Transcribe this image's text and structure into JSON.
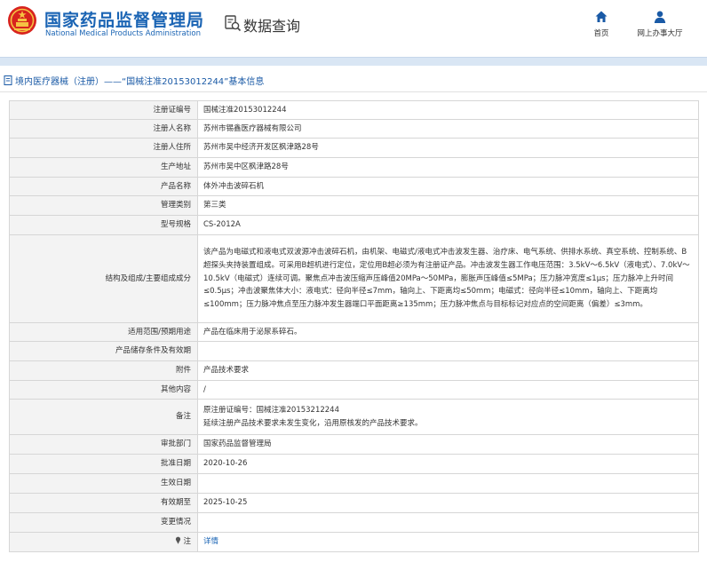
{
  "header": {
    "site_title_cn": "国家药品监督管理局",
    "site_title_en": "National Medical Products Administration",
    "query_title": "数据查询",
    "nav": {
      "home_label": "首页",
      "office_label": "网上办事大厅"
    },
    "brand_color": "#1a64b4",
    "emblem_color": "#d8231e"
  },
  "breadcrumb": {
    "text": "境内医疗器械（注册）——“国械注准20153012244”基本信息"
  },
  "rows": [
    {
      "label": "注册证编号",
      "value": "国械注准20153012244"
    },
    {
      "label": "注册人名称",
      "value": "苏州市锡鑫医疗器械有限公司"
    },
    {
      "label": "注册人住所",
      "value": "苏州市吴中经济开发区枫津路28号"
    },
    {
      "label": "生产地址",
      "value": "苏州市吴中区枫津路28号"
    },
    {
      "label": "产品名称",
      "value": "体外冲击波碎石机"
    },
    {
      "label": "管理类别",
      "value": "第三类"
    },
    {
      "label": "型号规格",
      "value": "CS-2012A"
    },
    {
      "label": "结构及组成/主要组成成分",
      "value": "该产品为电磁式和液电式双波源冲击波碎石机，由机架、电磁式/液电式冲击波发生器、治疗床、电气系统、供排水系统、真空系统、控制系统、B超探头夹持装置组成。可采用B超机进行定位，定位用B超必须为有注册证产品。冲击波发生器工作电压范围：3.5kV～6.5kV（液电式）、7.0kV～10.5kV（电磁式）连续可调。聚焦点冲击波压缩声压峰值20MPa～50MPa，膨胀声压峰值≤5MPa；压力脉冲宽度≤1μs；压力脉冲上升时间≤0.5μs；冲击波聚焦体大小：液电式：径向半径≤7mm，轴向上、下距离均≤50mm；电磁式：径向半径≤10mm，轴向上、下距离均≤100mm；压力脉冲焦点至压力脉冲发生器端口平面距离≥135mm；压力脉冲焦点与目标标记对应点的空间距离（偏差）≤3mm。"
    },
    {
      "label": "适用范围/预期用途",
      "value": "产品在临床用于泌尿系碎石。"
    },
    {
      "label": "产品储存条件及有效期",
      "value": ""
    },
    {
      "label": "附件",
      "value": "产品技术要求"
    },
    {
      "label": "其他内容",
      "value": "/"
    },
    {
      "label": "备注",
      "value_lines": [
        "原注册证编号：国械注准20153212244",
        "延续注册产品技术要求未发生变化，沿用原核发的产品技术要求。"
      ]
    },
    {
      "label": "审批部门",
      "value": "国家药品监督管理局"
    },
    {
      "label": "批准日期",
      "value": "2020-10-26"
    },
    {
      "label": "生效日期",
      "value": ""
    },
    {
      "label": "有效期至",
      "value": "2025-10-25"
    },
    {
      "label": "变更情况",
      "value": ""
    },
    {
      "label": "注",
      "value": "详情",
      "label_icon": "pin-icon"
    }
  ]
}
